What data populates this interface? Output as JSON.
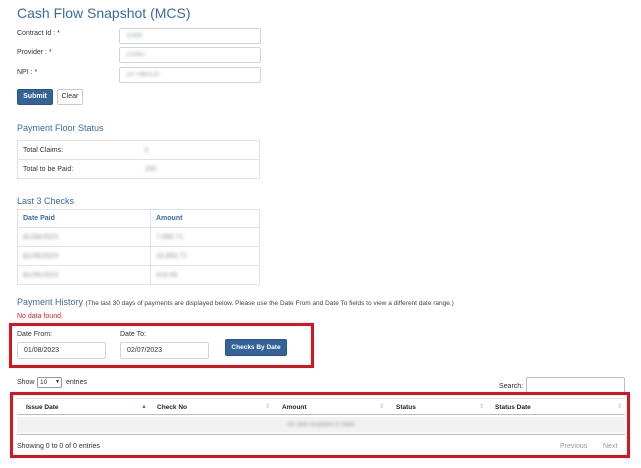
{
  "page": {
    "title": "Cash Flow Snapshot (MCS)"
  },
  "form": {
    "contract_label": "Contract Id : *",
    "contract_value": "11560",
    "provider_label": "Provider : *",
    "provider_value": "223457",
    "npi_label": "NPI : *",
    "npi_value": "1477865120",
    "submit_label": "Submit",
    "clear_label": "Clear"
  },
  "payment_floor": {
    "title": "Payment Floor Status",
    "rows": [
      {
        "label": "Total Claims:",
        "value": "0"
      },
      {
        "label": "Total to be Paid:",
        "value": "100"
      }
    ]
  },
  "last_checks": {
    "title": "Last 3 Checks",
    "headers": [
      "Date Paid",
      "Amount"
    ],
    "rows": [
      [
        "$1/06/2023",
        "7,090.71"
      ],
      [
        "$1/06/2023",
        "15,850.71"
      ],
      [
        "$1/06/2023",
        "419.06"
      ]
    ]
  },
  "payment_history": {
    "title": "Payment History",
    "note": "(The last 30 days of payments are displayed below. Please use the Date From and Date To fields to view a different date range.)",
    "no_data": "No data found.",
    "date_from_label": "Date From:",
    "date_from_value": "01/08/2023",
    "date_to_label": "Date To:",
    "date_to_value": "02/07/2023",
    "checks_button": "Checks By Date"
  },
  "grid": {
    "show_label": "Show",
    "page_size": "10",
    "entries_label": "entries",
    "search_label": "Search:",
    "columns": [
      "Issue Date",
      "Check No",
      "Amount",
      "Status",
      "Status Date"
    ],
    "empty_message": "No data available in table",
    "info": "Showing 0 to 0 of 0 entries",
    "previous": "Previous",
    "next": "Next"
  },
  "colors": {
    "brand_blue": "#34639a",
    "title_blue": "#3b6aa0",
    "highlight_red": "#d7141f",
    "error_red": "#d9232d"
  }
}
